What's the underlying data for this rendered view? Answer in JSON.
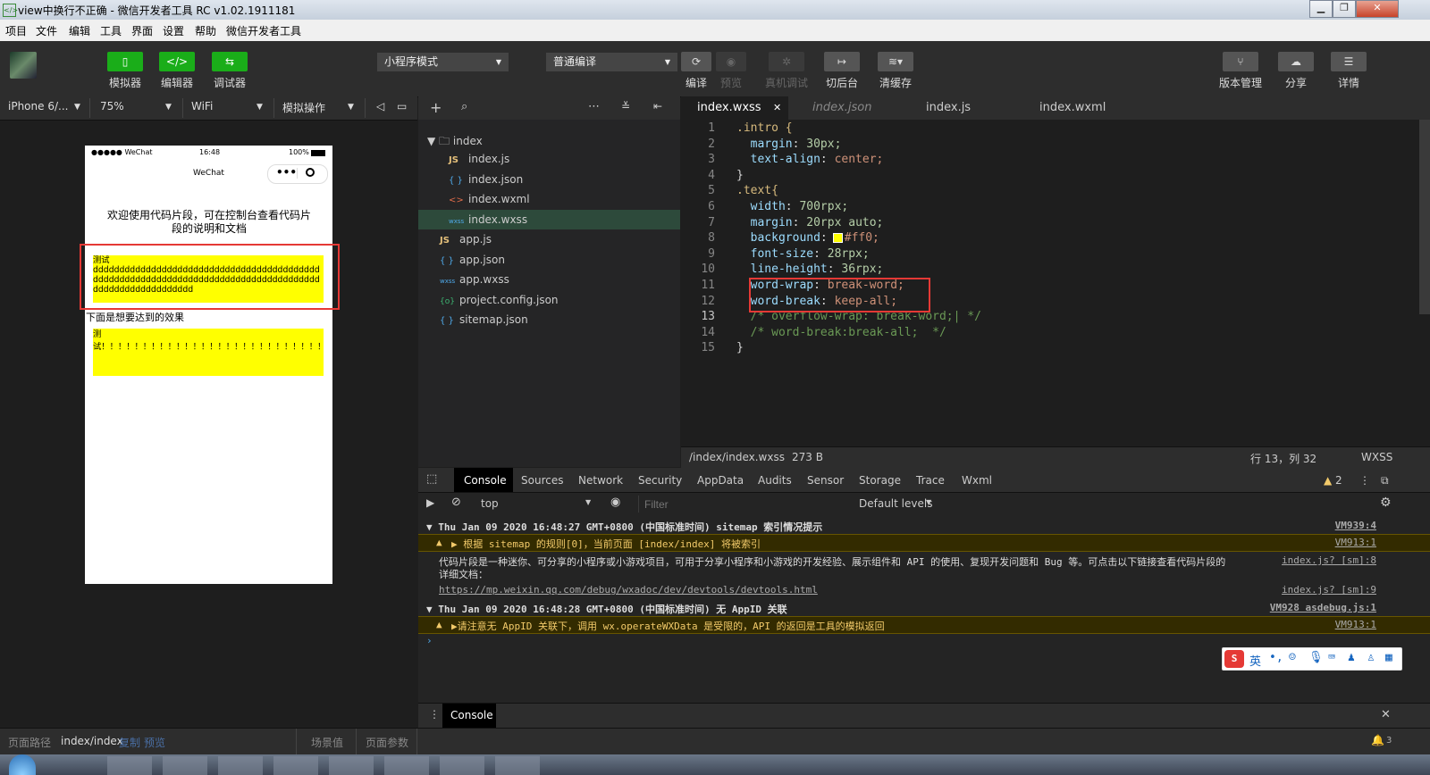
{
  "window": {
    "title": "view中换行不正确 - 微信开发者工具 RC v1.02.1911181",
    "minimize": "▁",
    "restore": "❐",
    "close": "✕"
  },
  "menu": [
    "项目",
    "文件",
    "编辑",
    "工具",
    "界面",
    "设置",
    "帮助",
    "微信开发者工具"
  ],
  "toolbar": {
    "simulator": "模拟器",
    "editor": "编辑器",
    "debugger": "调试器",
    "mode": "小程序模式",
    "compile_mode": "普通编译",
    "compile": "编译",
    "preview": "预览",
    "real_debug": "真机调试",
    "background": "切后台",
    "clear_cache": "清缓存",
    "version": "版本管理",
    "share": "分享",
    "details": "详情"
  },
  "simbar": {
    "device": "iPhone 6/...",
    "zoom": "75%",
    "network": "WiFi",
    "simulate": "模拟操作"
  },
  "phone": {
    "status_left": "●●●●● WeChat",
    "time": "16:48",
    "battery": "100%",
    "nav_title": "WeChat",
    "intro": "欢迎使用代码片段，可在控制台查看代码片段的说明和文档",
    "text1_label": "测试",
    "text1_body": "ddddddddddddddddddddddddddddddddddddddddddddddddddddddddddddddddddddddddddddddddddddddddddddddddddddddddd",
    "caption": "下面是想要达到的效果",
    "text2": "测试！！！！！！！！！！！！！！！！！！！！！！！！！！！！！！！！！！！！！！！！！！！！！！！！！！！！！！！！"
  },
  "filetree": {
    "folder": "index",
    "files": [
      {
        "icon": "JS",
        "name": "index.js",
        "color": "#e5c07b"
      },
      {
        "icon": "{ }",
        "name": "index.json",
        "color": "#4fa9e9"
      },
      {
        "icon": "<>",
        "name": "index.wxml",
        "color": "#e06c4a"
      },
      {
        "icon": "wxss",
        "name": "index.wxss",
        "color": "#4fa9e9"
      }
    ],
    "root_files": [
      {
        "icon": "JS",
        "name": "app.js",
        "color": "#e5c07b"
      },
      {
        "icon": "{ }",
        "name": "app.json",
        "color": "#4fa9e9"
      },
      {
        "icon": "wxss",
        "name": "app.wxss",
        "color": "#4fa9e9"
      },
      {
        "icon": "{o}",
        "name": "project.config.json",
        "color": "#3cb371"
      },
      {
        "icon": "{ }",
        "name": "sitemap.json",
        "color": "#4fa9e9"
      }
    ]
  },
  "tabs": [
    "index.wxss",
    "index.json",
    "index.js",
    "index.wxml"
  ],
  "code": [
    ".intro {",
    "  margin: 30px;",
    "  text-align: center;",
    "}",
    ".text{",
    "  width: 700rpx;",
    "  margin: 20rpx auto;",
    "  background: #ff0;",
    "  font-size: 28rpx;",
    "  line-height: 36rpx;",
    "  word-wrap: break-word;",
    "  word-break: keep-all;",
    "  /* overflow-wrap: break-word;| */",
    "  /* word-break:break-all;  */",
    "}"
  ],
  "status": {
    "path": "/index/index.wxss",
    "size": "273 B",
    "position": "行 13，列 32",
    "lang": "WXSS"
  },
  "devtools": {
    "tabs": [
      "Console",
      "Sources",
      "Network",
      "Security",
      "AppData",
      "Audits",
      "Sensor",
      "Storage",
      "Trace",
      "Wxml"
    ],
    "warn_count": "2",
    "context": "top",
    "filter_placeholder": "Filter",
    "levels": "Default levels"
  },
  "console": [
    {
      "text": "▼ Thu Jan 09 2020 16:48:27 GMT+0800 (中国标准时间) sitemap 索引情况提示",
      "src": "VM939:4",
      "kind": "group"
    },
    {
      "text": "▶ 根据 sitemap 的规则[0]，当前页面 [index/index] 将被索引",
      "src": "VM913:1",
      "kind": "warn"
    },
    {
      "text": "代码片段是一种迷你、可分享的小程序或小游戏项目，可用于分享小程序和小游戏的开发经验、展示组件和 API 的使用、复现开发问题和 Bug 等。可点击以下链接查看代码片段的",
      "text2": "详细文档：",
      "src": "index.js? [sm]:8",
      "kind": "info"
    },
    {
      "text": "https://mp.weixin.qq.com/debug/wxadoc/dev/devtools/devtools.html",
      "src": "index.js? [sm]:9",
      "kind": "url"
    },
    {
      "text": "▼ Thu Jan 09 2020 16:48:28 GMT+0800 (中国标准时间) 无 AppID 关联",
      "src": "VM928 asdebug.js:1",
      "kind": "group"
    },
    {
      "text": "▶请注意无 AppID 关联下，调用 wx.operateWXData 是受限的，API 的返回是工具的模拟返回",
      "src": "VM913:1",
      "kind": "warn"
    }
  ],
  "drawer": {
    "tab": "Console"
  },
  "bottom": {
    "path_label": "页面路径",
    "path": "index/index",
    "copy": "复制",
    "preview": "预览",
    "scene": "场景值",
    "params": "页面参数",
    "notifications": "3"
  },
  "ime": {
    "lang": "英"
  }
}
